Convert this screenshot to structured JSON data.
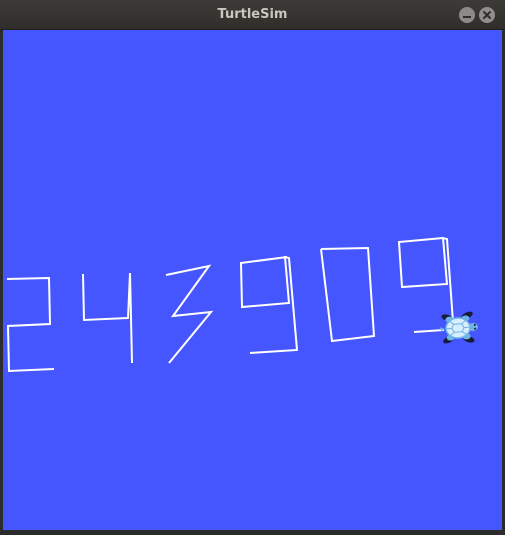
{
  "window": {
    "title": "TurtleSim",
    "controls": [
      "minimize-icon",
      "close-icon"
    ]
  },
  "canvas": {
    "background_color": "#4556ff",
    "pen_color": "#ffffff",
    "drawn_text": "243909"
  },
  "turtle": {
    "icon": "turtle-icon",
    "shell_color": "#9fd3f5",
    "body_color": "#6fb4e6"
  }
}
